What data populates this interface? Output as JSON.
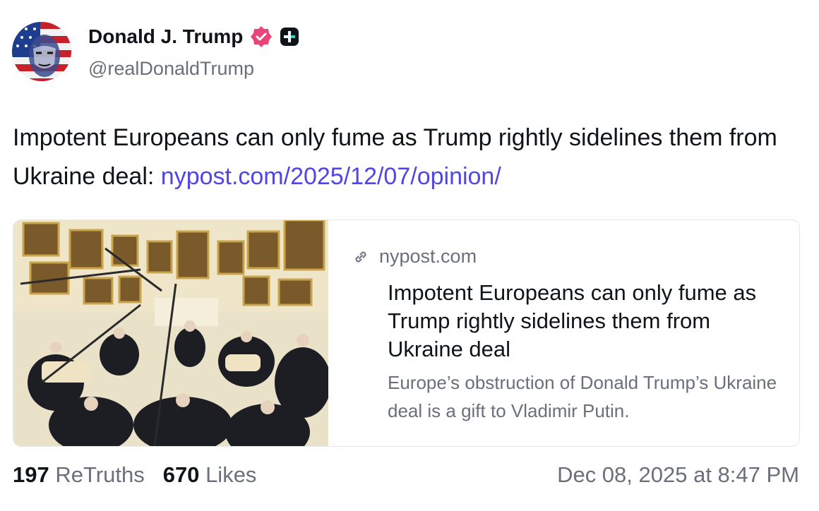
{
  "author": {
    "display_name": "Donald J. Trump",
    "handle": "@realDonaldTrump",
    "verified_badge_icon": "verified-badge-icon",
    "plus_badge_icon": "plus-badge-icon",
    "avatar_icon": "avatar-flag-portrait"
  },
  "post": {
    "text": "Impotent Europeans can only fume as Trump rightly sidelines them from Ukraine deal: ",
    "link_text": "nypost.com/2025/12/07/opinion/"
  },
  "link_card": {
    "image": "oval-office-photo",
    "link_icon": "link-icon",
    "domain": "nypost.com",
    "title": "Impotent Europeans can only fume as Trump rightly sidelines them from Ukraine deal",
    "description": "Europe’s obstruction of Donald Trump’s Ukraine deal is a gift to Vladimir Putin."
  },
  "stats": {
    "retruths_count": "197",
    "retruths_label": "ReTruths",
    "likes_count": "670",
    "likes_label": "Likes"
  },
  "timestamp": "Dec 08, 2025 at 8:47 PM",
  "colors": {
    "link": "#4f46e5",
    "verified": "#e8457a",
    "muted": "#6b6f7b"
  }
}
